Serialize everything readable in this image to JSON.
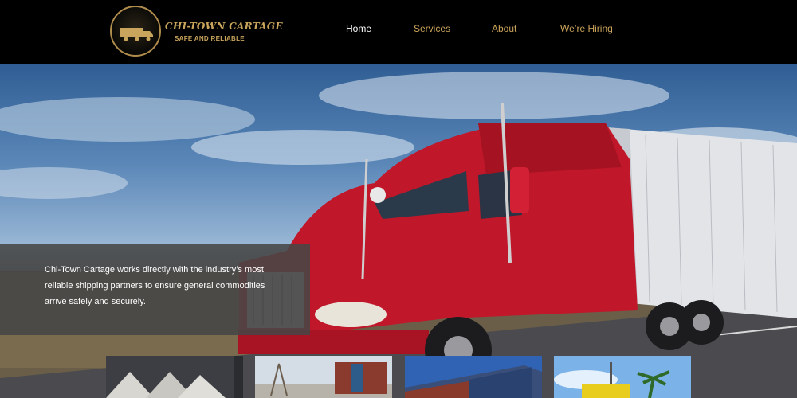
{
  "header": {
    "logo": {
      "title": "CHI-TOWN CARTAGE",
      "tagline": "SAFE AND RELIABLE"
    },
    "nav": [
      {
        "label": "Home",
        "active": true
      },
      {
        "label": "Services",
        "active": false
      },
      {
        "label": "About",
        "active": false
      },
      {
        "label": "We’re Hiring",
        "active": false
      }
    ]
  },
  "hero": {
    "intro_text": "Chi-Town Cartage works directly with the industry’s most reliable shipping partners to ensure general commodities arrive safely and securely."
  },
  "colors": {
    "accent_gold": "#c9a35a",
    "header_bg": "#000000",
    "truck_red": "#c0182a"
  }
}
